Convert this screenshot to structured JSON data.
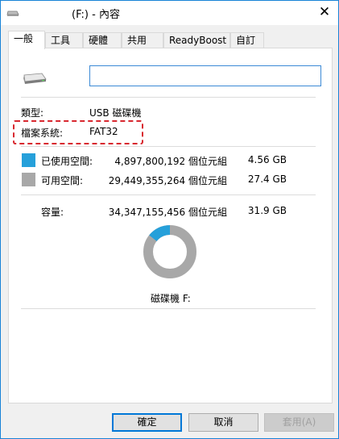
{
  "window": {
    "title": "(F:) - 內容",
    "close_glyph": "✕"
  },
  "tabs": [
    {
      "label": "一般",
      "active": true
    },
    {
      "label": "工具",
      "active": false
    },
    {
      "label": "硬體",
      "active": false
    },
    {
      "label": "共用",
      "active": false
    },
    {
      "label": "ReadyBoost",
      "active": false
    },
    {
      "label": "自訂",
      "active": false
    }
  ],
  "general": {
    "volume_name_value": "",
    "type_label": "類型:",
    "type_value": "USB 磁碟機",
    "fs_label": "檔案系統:",
    "fs_value": "FAT32",
    "used": {
      "label": "已使用空間:",
      "bytes": "4,897,800,192 個位元組",
      "size": "4.56 GB",
      "color": "#26a0da"
    },
    "free": {
      "label": "可用空間:",
      "bytes": "29,449,355,264 個位元組",
      "size": "27.4 GB",
      "color": "#a8a8a8"
    },
    "capacity": {
      "label": "容量:",
      "bytes": "34,347,155,456 個位元組",
      "size": "31.9 GB"
    },
    "used_fraction": 0.1426,
    "drive_caption": "磁碟機 F:"
  },
  "highlight_color": "#d8282f",
  "buttons": {
    "ok": "確定",
    "cancel": "取消",
    "apply": "套用(A)"
  }
}
